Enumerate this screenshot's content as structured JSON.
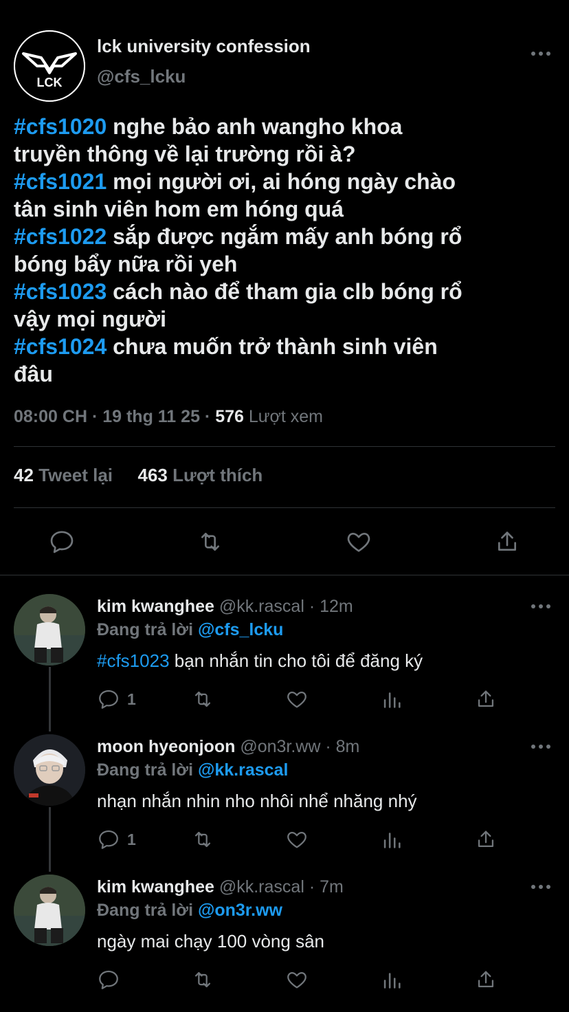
{
  "main_tweet": {
    "author_name": "lck university confession",
    "author_handle": "@cfs_lcku",
    "avatar_text": "LCK",
    "lines": [
      {
        "tag": "#cfs1020",
        "text": " nghe bảo anh wangho khoa"
      },
      {
        "tag": "",
        "text": "truyền thông về lại trường rồi à?"
      },
      {
        "tag": "#cfs1021",
        "text": " mọi người ơi, ai hóng ngày chào"
      },
      {
        "tag": "",
        "text": "tân sinh viên hom em hóng quá"
      },
      {
        "tag": "#cfs1022",
        "text": " sắp được ngắm mấy anh bóng rổ"
      },
      {
        "tag": "",
        "text": "bóng bẩy nữa rồi yeh"
      },
      {
        "tag": "#cfs1023",
        "text": " cách nào để tham gia clb bóng rổ"
      },
      {
        "tag": "",
        "text": "vậy mọi người"
      },
      {
        "tag": "#cfs1024",
        "text": " chưa muốn trở thành sinh viên"
      },
      {
        "tag": "",
        "text": "đâu"
      }
    ],
    "time": "08:00 CH",
    "separator": " · ",
    "date": "19 thg 11 25",
    "views_count": "576",
    "views_label": " Lượt xem",
    "retweets_count": "42",
    "retweets_label": " Tweet lại",
    "likes_count": "463",
    "likes_label": " Lượt thích",
    "actions": [
      "reply-icon",
      "retweet-icon",
      "like-icon",
      "share-icon"
    ]
  },
  "replies": [
    {
      "name": "kim kwanghee",
      "handle": "@kk.rascal",
      "time": " · 12m",
      "replying_prefix": "Đang trả lời ",
      "replying_to": "@cfs_lcku",
      "tag": "#cfs1023",
      "text": " bạn nhắn tin cho tôi để đăng ký",
      "reply_count": "1"
    },
    {
      "name": "moon hyeonjoon",
      "handle": "@on3r.ww",
      "time": " · 8m",
      "replying_prefix": "Đang trả lời ",
      "replying_to": "@kk.rascal",
      "tag": "",
      "text": "nhạn nhắn nhin nho nhôi nhể nhăng nhý",
      "reply_count": "1"
    },
    {
      "name": "kim kwanghee",
      "handle": "@kk.rascal",
      "time": " · 7m",
      "replying_prefix": "Đang trả lời ",
      "replying_to": "@on3r.ww",
      "tag": "",
      "text": "ngày mai chạy 100 vòng sân",
      "reply_count": ""
    }
  ],
  "colors": {
    "background": "#000000",
    "text": "#e7e9ea",
    "muted": "#71767b",
    "link": "#1d9bf0",
    "divider": "#2f3336"
  }
}
